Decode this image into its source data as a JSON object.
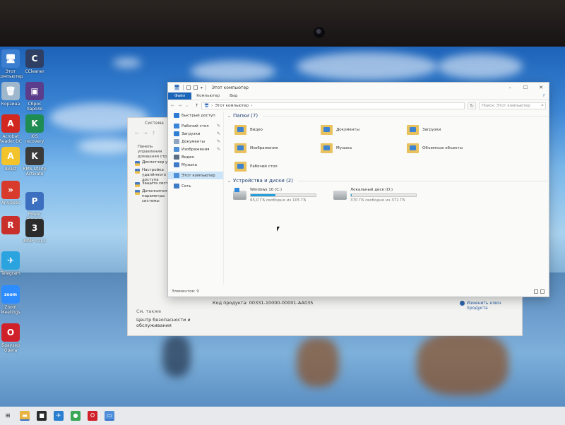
{
  "desktop_icons": [
    {
      "id": "pc",
      "label": "Этот\nкомпьютер",
      "glyph": "🖥",
      "color": "#3c7fd0"
    },
    {
      "id": "ccleaner",
      "label": "CCleaner",
      "glyph": "C",
      "color": "#2f3f63"
    },
    {
      "id": "recycle",
      "label": "Корзина",
      "glyph": "🗑",
      "color": "#9fb7cc"
    },
    {
      "id": "winrar",
      "label": "Сброс\nпароля",
      "glyph": "▣",
      "color": "#5b3d8c"
    },
    {
      "id": "acrobat",
      "label": "Acrobat\nReader DC",
      "glyph": "A",
      "color": "#d2271e"
    },
    {
      "id": "kaspersky",
      "label": "KIS\nrecovery",
      "glyph": "K",
      "color": "#1f8c54"
    },
    {
      "id": "avast",
      "label": "Avast",
      "glyph": "A",
      "color": "#f3c32b"
    },
    {
      "id": "kms",
      "label": "KMS Utility\nActivate",
      "glyph": "K",
      "color": "#3a3a3a"
    },
    {
      "id": "anydesk",
      "label": "AnyDesk",
      "glyph": "»",
      "color": "#d83b2c"
    },
    {
      "id": "firewall",
      "label": "Power\nBackup",
      "glyph": "P",
      "color": "#3c6fbf"
    },
    {
      "id": "rar",
      "label": "",
      "glyph": "R",
      "color": "#c9302c"
    },
    {
      "id": "aimp",
      "label": "AIMP 4.0.1",
      "glyph": "3",
      "color": "#2c2c2c"
    },
    {
      "id": "telegram",
      "label": "Telegram",
      "glyph": "✈",
      "color": "#2aa3de"
    },
    {
      "id": "zoom",
      "label": "Zoom\nMeetings",
      "glyph": "zoom",
      "color": "#2d8cff"
    },
    {
      "id": "opera",
      "label": "Браузер\nOpera",
      "glyph": "O",
      "color": "#d0212b"
    }
  ],
  "system_window": {
    "title": "Система",
    "panel_text": "Панель управления домашняя стр",
    "links": [
      "Диспетчер устр",
      "Настройка удалённого доступа",
      "Защита системы",
      "Дополнительные параметры системы"
    ],
    "see_also": "См. также",
    "security_center": "Центр безопасности и обслуживания",
    "product_code": "Код продукта: 00331-10000-00001-AA035",
    "activate_key": "Изменить ключ продукта"
  },
  "explorer": {
    "title": "Этот компьютер",
    "ribbon_tabs": [
      "Файл",
      "Компьютер",
      "Вид"
    ],
    "address": "Этот компьютер",
    "search_placeholder": "Поиск: Этот компьютер",
    "sidebar": [
      {
        "label": "Быстрый доступ",
        "icon": "star-icon",
        "color": "#2e7bd6",
        "pinned": false
      },
      {
        "label": "Рабочий стол",
        "icon": "desktop-icon",
        "color": "#3b86d8",
        "pinned": true
      },
      {
        "label": "Загрузки",
        "icon": "download-icon",
        "color": "#2f80d5",
        "pinned": true
      },
      {
        "label": "Документы",
        "icon": "document-icon",
        "color": "#8fa6c1",
        "pinned": true
      },
      {
        "label": "Изображения",
        "icon": "picture-icon",
        "color": "#4c8fd6",
        "pinned": true
      },
      {
        "label": "Видео",
        "icon": "video-icon",
        "color": "#5a6f86",
        "pinned": false
      },
      {
        "label": "Музыка",
        "icon": "music-icon",
        "color": "#3f7bc9",
        "pinned": false
      },
      {
        "label": "Этот компьютер",
        "icon": "computer-icon",
        "color": "#4d8fd9",
        "pinned": false,
        "selected": true
      },
      {
        "label": "Сеть",
        "icon": "network-icon",
        "color": "#3f7cc6",
        "pinned": false
      }
    ],
    "folders_header": "Папки (7)",
    "folders": [
      "Видео",
      "Документы",
      "Загрузки",
      "Изображения",
      "Музыка",
      "Объемные объекты",
      "Рабочий стол"
    ],
    "drives_header": "Устройства и диски (2)",
    "drives": [
      {
        "name": "Windows 10 (C:)",
        "free": "65,0 ГБ свободно из 105 ГБ",
        "used_fraction": 0.38,
        "windows": true
      },
      {
        "name": "Локальный диск (D:)",
        "free": "370 ГБ свободно из 371 ГБ",
        "used_fraction": 0.01,
        "windows": false
      }
    ],
    "status": "Элементов: 9"
  },
  "taskbar_icons": [
    {
      "id": "start",
      "glyph": "⊞",
      "color": "#333"
    },
    {
      "id": "explorer",
      "glyph": "▬",
      "color": "#e8b441"
    },
    {
      "id": "store",
      "glyph": "■",
      "color": "#2b2b2b"
    },
    {
      "id": "network",
      "glyph": "✈",
      "color": "#2a7fd0"
    },
    {
      "id": "chrome",
      "glyph": "●",
      "color": "#3aa757"
    },
    {
      "id": "opera",
      "glyph": "O",
      "color": "#d0212b"
    },
    {
      "id": "window",
      "glyph": "▭",
      "color": "#4f8fda"
    }
  ]
}
